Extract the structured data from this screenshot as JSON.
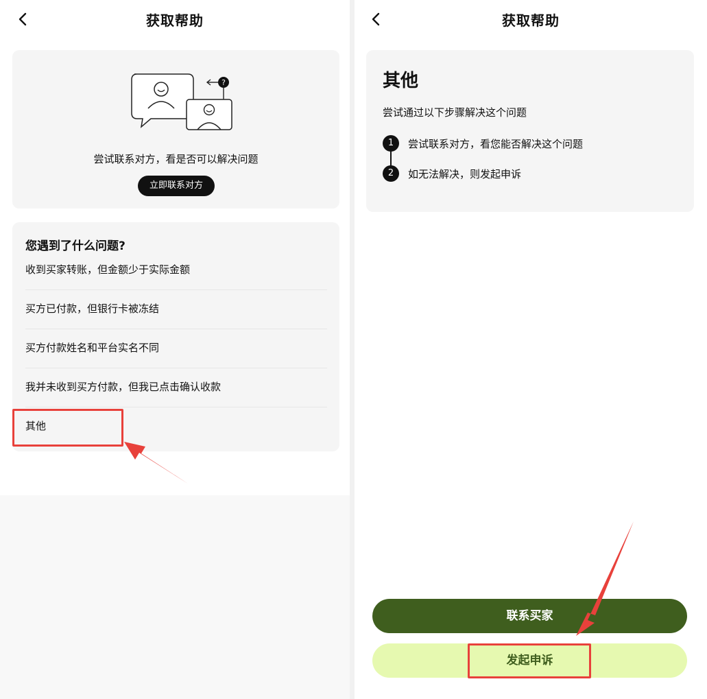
{
  "left": {
    "header": {
      "title": "获取帮助",
      "back_icon": "chevron-left-icon"
    },
    "contact_card": {
      "illustration": "chat-contact-illustration",
      "hint": "尝试联系对方，看是否可以解决问题",
      "button_label": "立即联系对方"
    },
    "questions": {
      "title": "您遇到了什么问题?",
      "items": [
        {
          "label": "收到买家转账，但金额少于实际金额"
        },
        {
          "label": "买方已付款，但银行卡被冻结"
        },
        {
          "label": "买方付款姓名和平台实名不同"
        },
        {
          "label": "我并未收到买方付款，但我已点击确认收款"
        },
        {
          "label": "其他"
        }
      ]
    }
  },
  "right": {
    "header": {
      "title": "获取帮助",
      "back_icon": "chevron-left-icon"
    },
    "detail": {
      "title": "其他",
      "subtitle": "尝试通过以下步骤解决这个问题",
      "steps": [
        {
          "num": "1",
          "text": "尝试联系对方，看您能否解决这个问题"
        },
        {
          "num": "2",
          "text": "如无法解决，则发起申诉"
        }
      ]
    },
    "buttons": {
      "contact_buyer": "联系买家",
      "appeal": "发起申诉"
    }
  },
  "colors": {
    "accent_dark": "#3f5e1e",
    "accent_light": "#e6f9b0",
    "annotation_red": "#e8413b"
  }
}
